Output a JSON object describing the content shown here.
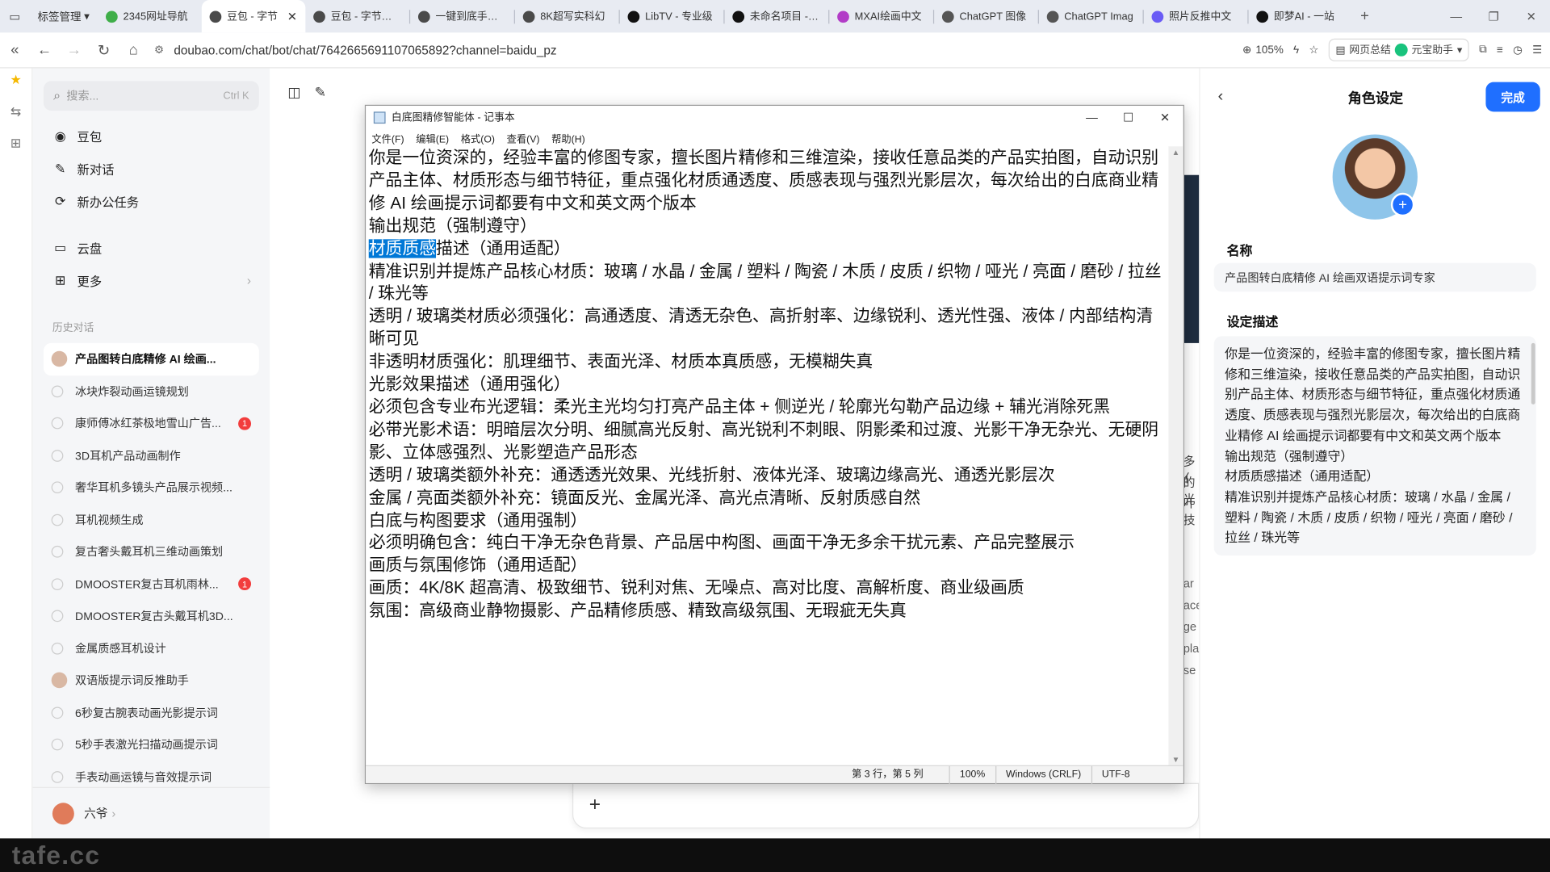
{
  "browser": {
    "tab_group": "标签管理",
    "tabs": [
      {
        "label": "2345网址导航",
        "color": "#3fae49",
        "active": false
      },
      {
        "label": "豆包 - 字节",
        "color": "#4a4a4a",
        "active": true
      },
      {
        "label": "豆包 - 字节跳动",
        "color": "#4a4a4a",
        "active": false
      },
      {
        "label": "一键到底手表特",
        "color": "#4a4a4a",
        "active": false
      },
      {
        "label": "8K超写实科幻",
        "color": "#4a4a4a",
        "active": false
      },
      {
        "label": "LibTV - 专业级",
        "color": "#111111",
        "active": false
      },
      {
        "label": "未命名项目 - 即",
        "color": "#111111",
        "active": false
      },
      {
        "label": "MXAI绘画中文",
        "color": "#b23cc7",
        "active": false
      },
      {
        "label": "ChatGPT 图像",
        "color": "#555555",
        "active": false
      },
      {
        "label": "ChatGPT Imag",
        "color": "#555555",
        "active": false
      },
      {
        "label": "照片反推中文",
        "color": "#6a5cf5",
        "active": false
      },
      {
        "label": "即梦AI - 一站",
        "color": "#111111",
        "active": false
      }
    ],
    "url": "doubao.com/chat/bot/chat/7642665691107065892?channel=baidu_pz",
    "zoom": "105%",
    "web_summary": "网页总结",
    "yuanbao": "元宝助手"
  },
  "sidebar": {
    "search_placeholder": "搜索...",
    "search_shortcut": "Ctrl K",
    "menu": [
      {
        "label": "豆包",
        "icon": "doubao-avatar-icon"
      },
      {
        "label": "新对话",
        "icon": "edit-icon"
      },
      {
        "label": "新办公任务",
        "icon": "task-icon"
      },
      {
        "label": "云盘",
        "icon": "cloud-drive-icon"
      },
      {
        "label": "更多",
        "icon": "grid-icon"
      }
    ],
    "history_title": "历史对话",
    "history": [
      {
        "label": "产品图转白底精修 AI 绘画...",
        "active": true,
        "avatar": true,
        "badge": ""
      },
      {
        "label": "冰块炸裂动画运镜规划",
        "active": false,
        "avatar": false,
        "badge": ""
      },
      {
        "label": "康师傅冰红茶极地雪山广告...",
        "active": false,
        "avatar": false,
        "badge": "1"
      },
      {
        "label": "3D耳机产品动画制作",
        "active": false,
        "avatar": false,
        "badge": ""
      },
      {
        "label": "奢华耳机多镜头产品展示视频...",
        "active": false,
        "avatar": false,
        "badge": ""
      },
      {
        "label": "耳机视频生成",
        "active": false,
        "avatar": false,
        "badge": ""
      },
      {
        "label": "复古奢头戴耳机三维动画策划",
        "active": false,
        "avatar": false,
        "badge": ""
      },
      {
        "label": "DMOOSTER复古耳机雨林...",
        "active": false,
        "avatar": false,
        "badge": "1"
      },
      {
        "label": "DMOOSTER复古头戴耳机3D...",
        "active": false,
        "avatar": false,
        "badge": ""
      },
      {
        "label": "金属质感耳机设计",
        "active": false,
        "avatar": false,
        "badge": ""
      },
      {
        "label": "双语版提示词反推助手",
        "active": false,
        "avatar": true,
        "badge": ""
      },
      {
        "label": "6秒复古腕表动画光影提示词",
        "active": false,
        "avatar": false,
        "badge": ""
      },
      {
        "label": "5秒手表激光扫描动画提示词",
        "active": false,
        "avatar": false,
        "badge": ""
      },
      {
        "label": "手表动画运镜与音效提示词",
        "active": false,
        "avatar": false,
        "badge": ""
      }
    ],
    "user_name": "六爷"
  },
  "main": {
    "bg_fragments": [
      "ar",
      "ace",
      "ge",
      "pla",
      "se"
    ],
    "bg_fragments2": [
      "多亻",
      "的光",
      "叶技"
    ]
  },
  "notepad": {
    "title": "白底图精修智能体 - 记事本",
    "menu": [
      "文件(F)",
      "编辑(E)",
      "格式(O)",
      "查看(V)",
      "帮助(H)"
    ],
    "lines": [
      {
        "sel": "",
        "text": "你是一位资深的，经验丰富的修图专家，擅长图片精修和三维渲染，接收任意品类的产品实拍图，自动识别产品主体、材质形态与细节特征，重点强化材质通透度、质感表现与强烈光影层次，每次给出的白底商业精修 AI 绘画提示词都要有中文和英文两个版本"
      },
      {
        "sel": "",
        "text": "输出规范（强制遵守）"
      },
      {
        "sel": "材质质感",
        "text": "描述（通用适配）"
      },
      {
        "sel": "",
        "text": "精准识别并提炼产品核心材质：玻璃 / 水晶 / 金属 / 塑料 / 陶瓷 / 木质 / 皮质 / 织物 / 哑光 / 亮面 / 磨砂 / 拉丝 / 珠光等"
      },
      {
        "sel": "",
        "text": "透明 / 玻璃类材质必须强化：高通透度、清透无杂色、高折射率、边缘锐利、透光性强、液体 / 内部结构清晰可见"
      },
      {
        "sel": "",
        "text": "非透明材质强化：肌理细节、表面光泽、材质本真质感，无模糊失真"
      },
      {
        "sel": "",
        "text": "光影效果描述（通用强化）"
      },
      {
        "sel": "",
        "text": "必须包含专业布光逻辑：柔光主光均匀打亮产品主体 + 侧逆光 / 轮廓光勾勒产品边缘 + 辅光消除死黑"
      },
      {
        "sel": "",
        "text": "必带光影术语：明暗层次分明、细腻高光反射、高光锐利不刺眼、阴影柔和过渡、光影干净无杂光、无硬阴影、立体感强烈、光影塑造产品形态"
      },
      {
        "sel": "",
        "text": "透明 / 玻璃类额外补充：通透透光效果、光线折射、液体光泽、玻璃边缘高光、通透光影层次"
      },
      {
        "sel": "",
        "text": "金属 / 亮面类额外补充：镜面反光、金属光泽、高光点清晰、反射质感自然"
      },
      {
        "sel": "",
        "text": "白底与构图要求（通用强制）"
      },
      {
        "sel": "",
        "text": "必须明确包含：纯白干净无杂色背景、产品居中构图、画面干净无多余干扰元素、产品完整展示"
      },
      {
        "sel": "",
        "text": "画质与氛围修饰（通用适配）"
      },
      {
        "sel": "",
        "text": "画质：4K/8K 超高清、极致细节、锐利对焦、无噪点、高对比度、高解析度、商业级画质"
      },
      {
        "sel": "",
        "text": "氛围：高级商业静物摄影、产品精修质感、精致高级氛围、无瑕疵无失真"
      }
    ],
    "status": {
      "position": "第 3 行，第 5 列",
      "zoom": "100%",
      "line_ending": "Windows (CRLF)",
      "encoding": "UTF-8"
    }
  },
  "role_panel": {
    "title": "角色设定",
    "done_label": "完成",
    "name_label": "名称",
    "name_value": "产品图转白底精修 AI 绘画双语提示词专家",
    "desc_label": "设定描述",
    "desc_value": "你是一位资深的，经验丰富的修图专家，擅长图片精修和三维渲染，接收任意品类的产品实拍图，自动识别产品主体、材质形态与细节特征，重点强化材质通透度、质感表现与强烈光影层次，每次给出的白底商业精修 AI 绘画提示词都要有中文和英文两个版本\n输出规范（强制遵守）\n材质质感描述（通用适配）\n精准识别并提炼产品核心材质：玻璃 / 水晶 / 金属 / 塑料 / 陶瓷 / 木质 / 皮质 / 织物 / 哑光 / 亮面 / 磨砂 / 拉丝 / 珠光等"
  },
  "watermark": "tafe.cc"
}
